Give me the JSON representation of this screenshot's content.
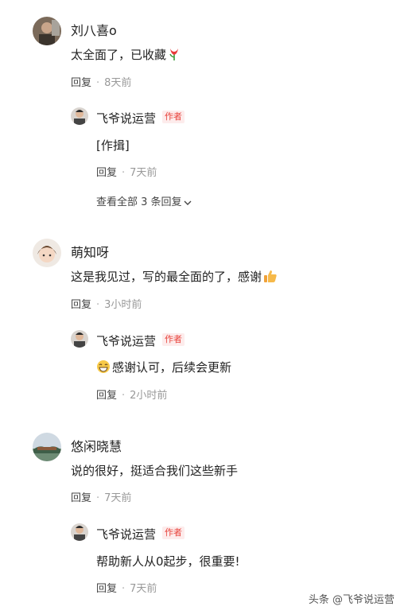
{
  "comments": [
    {
      "user": "刘八喜o",
      "text": "太全面了，已收藏",
      "emoji": "tulip-emoji",
      "reply_label": "回复",
      "time": "8天前",
      "author_reply": {
        "user": "飞爷说运营",
        "badge": "作者",
        "text": "[作揖]",
        "reply_label": "回复",
        "time": "7天前"
      },
      "view_all": "查看全部 3 条回复"
    },
    {
      "user": "萌知呀",
      "text": "这是我见过，写的最全面的了，感谢",
      "emoji": "thumbs-up-emoji",
      "reply_label": "回复",
      "time": "3小时前",
      "author_reply": {
        "user": "飞爷说运营",
        "badge": "作者",
        "text": "感谢认可，后续会更新",
        "emoji": "grin-emoji",
        "reply_label": "回复",
        "time": "2小时前"
      }
    },
    {
      "user": "悠闲晓慧",
      "text": "说的很好，挺适合我们这些新手",
      "reply_label": "回复",
      "time": "7天前",
      "author_reply": {
        "user": "飞爷说运营",
        "badge": "作者",
        "text": "帮助新人从0起步，很重要!",
        "reply_label": "回复",
        "time": "7天前"
      }
    }
  ],
  "watermark": "头条 @飞爷说运营"
}
